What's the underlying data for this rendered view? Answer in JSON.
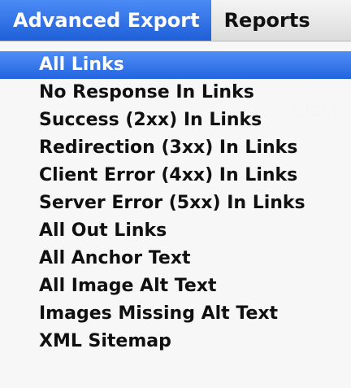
{
  "menubar": {
    "menus": [
      {
        "label": "Advanced Export",
        "active": true
      },
      {
        "label": "Reports",
        "active": false
      }
    ],
    "accent_color": "#2f6ee8"
  },
  "dropdown": {
    "items": [
      {
        "label": "All Links",
        "selected": true
      },
      {
        "label": "No Response In Links",
        "selected": false
      },
      {
        "label": "Success (2xx) In Links",
        "selected": false
      },
      {
        "label": "Redirection (3xx) In Links",
        "selected": false
      },
      {
        "label": "Client Error (4xx) In Links",
        "selected": false
      },
      {
        "label": "Server Error (5xx) In Links",
        "selected": false
      },
      {
        "label": "All Out Links",
        "selected": false
      },
      {
        "label": "All Anchor Text",
        "selected": false
      },
      {
        "label": "All Image Alt Text",
        "selected": false
      },
      {
        "label": "Images Missing Alt Text",
        "selected": false
      },
      {
        "label": "XML Sitemap",
        "selected": false
      }
    ]
  }
}
